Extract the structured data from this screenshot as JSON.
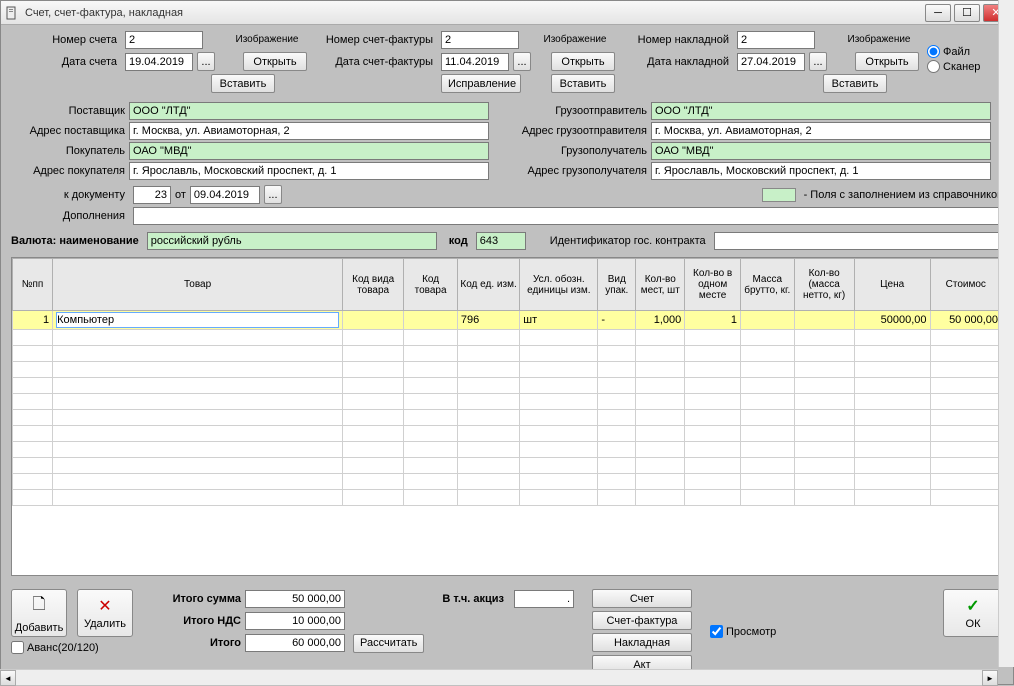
{
  "window": {
    "title": "Счет, счет-фактура, накладная"
  },
  "header": {
    "image_label": "Изображение",
    "open": "Открыть",
    "insert": "Вставить",
    "correction": "Исправление",
    "radio_file": "Файл",
    "radio_scanner": "Сканер",
    "invoice_no_label": "Номер счета",
    "invoice_no": "2",
    "invoice_date_label": "Дата счета",
    "invoice_date": "19.04.2019",
    "factura_no_label": "Номер счет-фактуры",
    "factura_no": "2",
    "factura_date_label": "Дата счет-фактуры",
    "factura_date": "11.04.2019",
    "waybill_no_label": "Номер накладной",
    "waybill_no": "2",
    "waybill_date_label": "Дата накладной",
    "waybill_date": "27.04.2019"
  },
  "parties": {
    "supplier_label": "Поставщик",
    "supplier": "ООО \"ЛТД\"",
    "supplier_addr_label": "Адрес поставщика",
    "supplier_addr": "г. Москва, ул. Авиамоторная, 2",
    "buyer_label": "Покупатель",
    "buyer": "ОАО \"МВД\"",
    "buyer_addr_label": "Адрес покупателя",
    "buyer_addr": "г. Ярославль, Московский проспект, д. 1",
    "shipper_label": "Грузоотправитель",
    "shipper": "ООО \"ЛТД\"",
    "shipper_addr_label": "Адрес грузоотправителя",
    "shipper_addr": "г. Москва, ул. Авиамоторная, 2",
    "consignee_label": "Грузополучатель",
    "consignee": "ОАО \"МВД\"",
    "consignee_addr_label": "Адрес грузополучателя",
    "consignee_addr": "г. Ярославль, Московский проспект, д. 1"
  },
  "doc": {
    "to_doc_label": "к документу",
    "to_doc_no": "23",
    "ot": "от",
    "to_doc_date": "09.04.2019",
    "extra_label": "Дополнения",
    "legend": "- Поля с заполнением из справочников"
  },
  "currency": {
    "name_label": "Валюта: наименование",
    "name": "российский рубль",
    "code_label": "код",
    "code": "643",
    "contract_label": "Идентификатор гос. контракта"
  },
  "grid": {
    "headers": [
      "№пп",
      "Товар",
      "Код вида товара",
      "Код товара",
      "Код ед. изм.",
      "Усл. обозн. единицы изм.",
      "Вид упак.",
      "Кол-во мест, шт",
      "Кол-во в одном месте",
      "Масса брутто, кг.",
      "Кол-во (масса нетто, кг)",
      "Цена",
      "Стоимос"
    ],
    "rows": [
      {
        "n": "1",
        "product": "Компьютер",
        "kind": "",
        "code": "",
        "unit_code": "796",
        "unit_name": "шт",
        "pack": "-",
        "places": "1,000",
        "per_place": "1",
        "gross": "",
        "qty": "",
        "price": "50000,00",
        "cost": "50 000,00"
      }
    ]
  },
  "totals": {
    "sum_label": "Итого сумма",
    "sum": "50 000,00",
    "vat_label": "Итого НДС",
    "vat": "10 000,00",
    "total_label": "Итого",
    "total": "60 000,00",
    "calc": "Рассчитать",
    "excise_label": "В т.ч. акциз",
    "excise": "."
  },
  "footer": {
    "add": "Добавить",
    "del": "Удалить",
    "avans": "Аванс(20/120)",
    "print_invoice": "Счет",
    "print_factura": "Счет-фактура",
    "print_waybill": "Накладная",
    "print_act": "Акт",
    "preview": "Просмотр",
    "ok": "ОК"
  }
}
